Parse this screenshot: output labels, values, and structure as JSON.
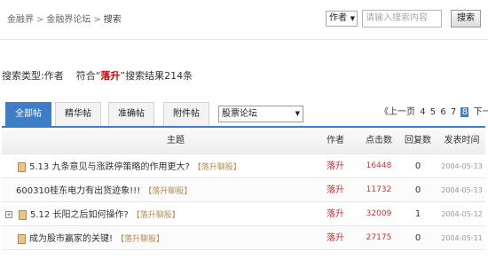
{
  "breadcrumb": [
    "金融界",
    "金融界论坛",
    "搜索"
  ],
  "search": {
    "type_value": "作者",
    "input_placeholder": "请输入搜索内容",
    "button_label": "搜索"
  },
  "result": {
    "type_label": "搜索类型:作者",
    "prefix": "符合“",
    "keyword": "落升",
    "suffix": "”搜索结果214条"
  },
  "tabs": [
    {
      "label": "全部帖",
      "active": true
    },
    {
      "label": "精华帖",
      "active": false
    },
    {
      "label": "准确帖",
      "active": false
    },
    {
      "label": "附件帖",
      "active": false
    }
  ],
  "forum_select": {
    "value": "股票论坛"
  },
  "pager": {
    "prev_label": "《上一页",
    "pages": [
      "4",
      "5",
      "6",
      "7"
    ],
    "current": "8",
    "next_label": "下一页"
  },
  "table": {
    "headers": [
      "主题",
      "作者",
      "点击数",
      "回复数",
      "发表时间"
    ],
    "rows": [
      {
        "title": "5.13 九条意见与涨跌停策略的作用更大?",
        "tag": "【落升聊股】",
        "author": "落升",
        "clicks": "16448",
        "replies": "0",
        "time": "2004-05-13",
        "icon": "folder-icon"
      },
      {
        "title": "600310桂东电力有出货迹象!!!",
        "tag": "【落升聊股】",
        "author": "落升",
        "clicks": "11732",
        "replies": "0",
        "time": "2004-05-13",
        "icon": ""
      },
      {
        "title": "5.12  长阳之后如何操作?",
        "tag": "【落升聊股】",
        "author": "落升",
        "clicks": "32009",
        "replies": "1",
        "time": "2004-05-12",
        "icon": "expand-icon"
      },
      {
        "title": "成为股市赢家的关键!",
        "tag": "【落升聊股】",
        "author": "落升",
        "clicks": "27175",
        "replies": "0",
        "time": "2004-05-11",
        "icon": "folder-icon"
      }
    ]
  }
}
